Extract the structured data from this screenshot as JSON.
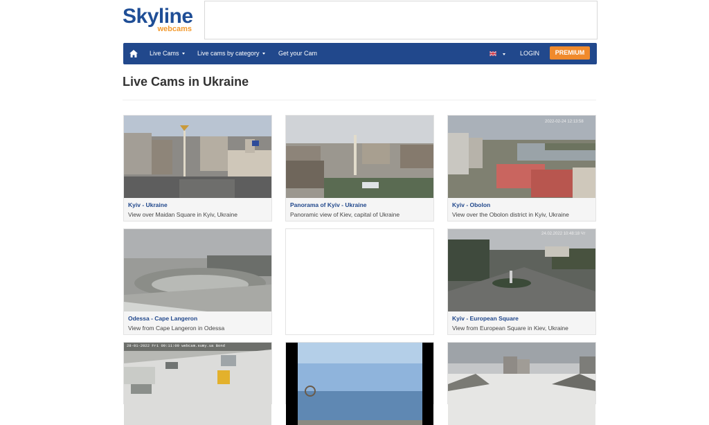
{
  "brand": {
    "name": "Skyline",
    "sub": "webcams"
  },
  "nav": {
    "live_cams": "Live Cams",
    "by_category": "Live cams by category",
    "get_cam": "Get your Cam",
    "login": "LOGIN",
    "premium": "PREMIUM"
  },
  "page": {
    "title": "Live Cams in Ukraine"
  },
  "cams": [
    {
      "title": "Kyiv - Ukraine",
      "desc": "View over Maidan Square in Kyiv, Ukraine"
    },
    {
      "title": "Panorama of Kyiv - Ukraine",
      "desc": "Panoramic view of Kiev, capital of Ukraine"
    },
    {
      "title": "Kyiv - Obolon",
      "desc": "View over the Obolon district in Kyiv, Ukraine"
    },
    {
      "title": "Odessa - Cape Langeron",
      "desc": "View from Cape Langeron in Odessa"
    },
    {
      "title": "Kyiv - European Square",
      "desc": "View from European Square in Kiev, Ukraine"
    }
  ],
  "overlays": {
    "obolon_ts": "2022-02-24 12:13:58",
    "european_ts": "24.02.2022 10:48:18 Чт",
    "sumy_ts": "28-01-2022 Fri 09:11:09   webcam.sumy.ua   Bond"
  },
  "icons": {
    "home": "home-icon",
    "flag": "uk-flag-icon",
    "caret": "caret-down-icon"
  },
  "colors": {
    "brand_blue": "#21488c",
    "accent_orange": "#f08a2c",
    "link_blue": "#21488c"
  }
}
